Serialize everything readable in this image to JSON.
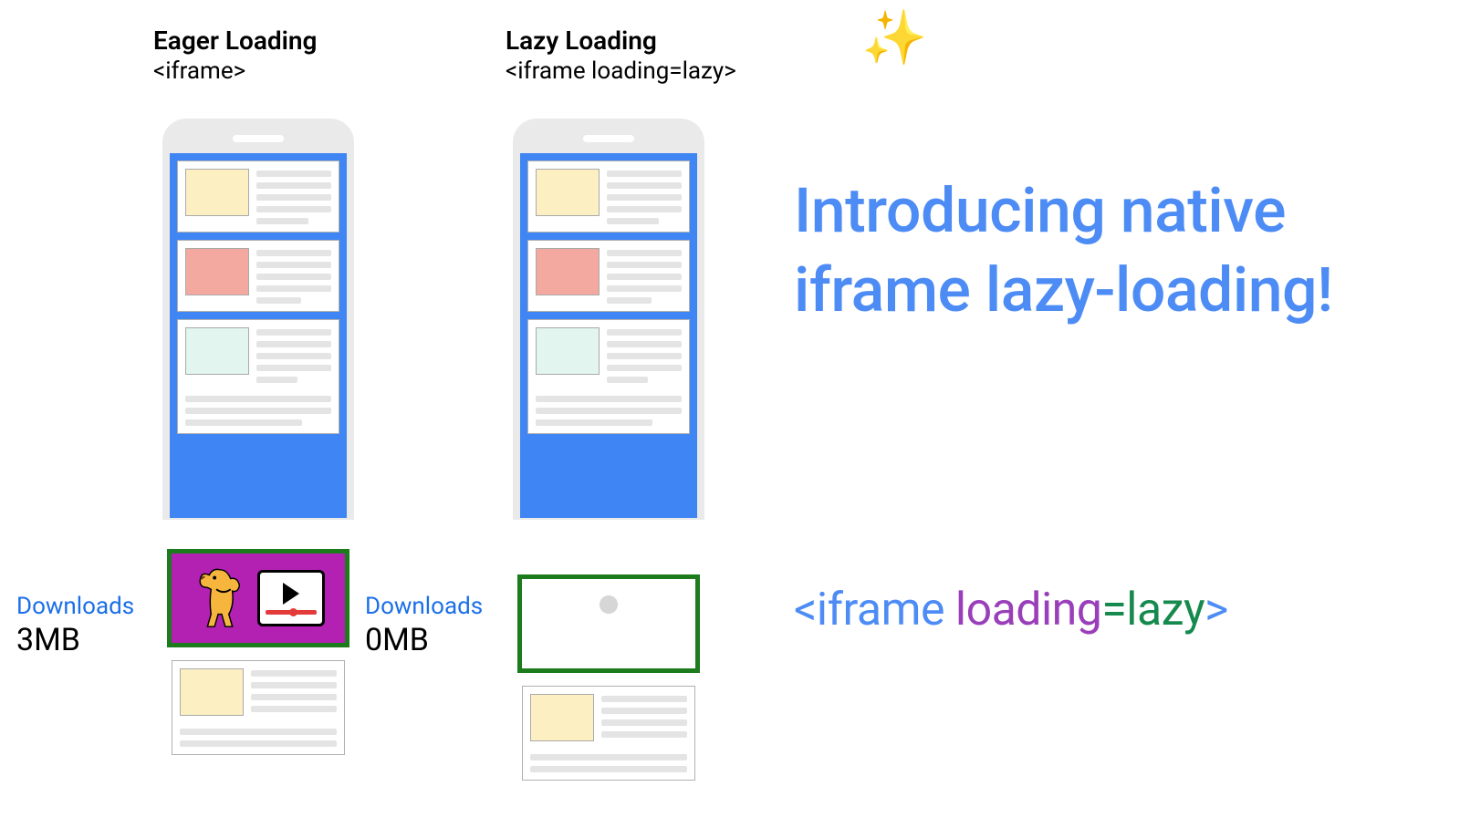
{
  "eager": {
    "title": "Eager Loading",
    "code": "<iframe>",
    "download_label": "Downloads",
    "download_value": "3MB"
  },
  "lazy": {
    "title": "Lazy Loading",
    "code": "<iframe loading=lazy>",
    "download_label": "Downloads",
    "download_value": "0MB"
  },
  "headline": "Introducing native iframe lazy-loading!",
  "code_snippet": {
    "bracket_open": "<",
    "tag": "iframe",
    "space": " ",
    "attr": "loading",
    "eq": "=",
    "val": "lazy",
    "bracket_close": ">"
  },
  "icons": {
    "sparkles": "✨"
  }
}
